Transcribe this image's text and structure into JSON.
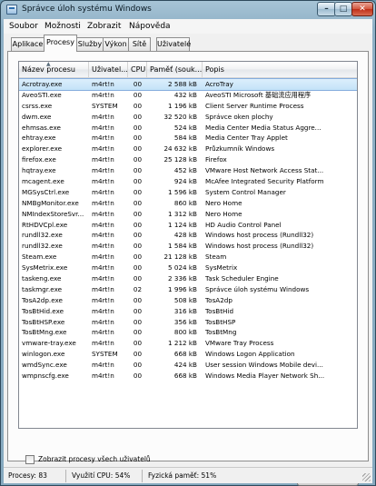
{
  "window": {
    "title": "Správce úloh systému Windows"
  },
  "menu": [
    "Soubor",
    "Možnosti",
    "Zobrazit",
    "Nápověda"
  ],
  "tabs": [
    "Aplikace",
    "Procesy",
    "Služby",
    "Výkon",
    "Sítě",
    "Uživatelé"
  ],
  "active_tab": "Procesy",
  "columns": [
    "Název procesu",
    "Uživatel...",
    "CPU",
    "Paměť (souk...",
    "Popis"
  ],
  "sort_column": "Název procesu",
  "processes": [
    {
      "name": "Acrotray.exe",
      "user": "m4rt!n",
      "cpu": "00",
      "mem": "2 588 kB",
      "desc": "AcroTray"
    },
    {
      "name": "AveoSTI.exe",
      "user": "m4rt!n",
      "cpu": "00",
      "mem": "432 kB",
      "desc": "AveoSTI Microsoft 基础流应用程序"
    },
    {
      "name": "csrss.exe",
      "user": "SYSTEM",
      "cpu": "00",
      "mem": "1 196 kB",
      "desc": "Client Server Runtime Process"
    },
    {
      "name": "dwm.exe",
      "user": "m4rt!n",
      "cpu": "00",
      "mem": "32 520 kB",
      "desc": "Správce oken plochy"
    },
    {
      "name": "ehmsas.exe",
      "user": "m4rt!n",
      "cpu": "00",
      "mem": "524 kB",
      "desc": "Media Center Media Status Aggre..."
    },
    {
      "name": "ehtray.exe",
      "user": "m4rt!n",
      "cpu": "00",
      "mem": "584 kB",
      "desc": "Media Center Tray Applet"
    },
    {
      "name": "explorer.exe",
      "user": "m4rt!n",
      "cpu": "00",
      "mem": "24 632 kB",
      "desc": "Průzkumník Windows"
    },
    {
      "name": "firefox.exe",
      "user": "m4rt!n",
      "cpu": "00",
      "mem": "25 128 kB",
      "desc": "Firefox"
    },
    {
      "name": "hqtray.exe",
      "user": "m4rt!n",
      "cpu": "00",
      "mem": "452 kB",
      "desc": "VMware Host Network Access Stat..."
    },
    {
      "name": "mcagent.exe",
      "user": "m4rt!n",
      "cpu": "00",
      "mem": "924 kB",
      "desc": "McAfee Integrated Security Platform"
    },
    {
      "name": "MGSysCtrl.exe",
      "user": "m4rt!n",
      "cpu": "00",
      "mem": "1 596 kB",
      "desc": "System Control Manager"
    },
    {
      "name": "NMBgMonitor.exe",
      "user": "m4rt!n",
      "cpu": "00",
      "mem": "860 kB",
      "desc": "Nero Home"
    },
    {
      "name": "NMIndexStoreSvr...",
      "user": "m4rt!n",
      "cpu": "00",
      "mem": "1 312 kB",
      "desc": "Nero Home"
    },
    {
      "name": "RtHDVCpl.exe",
      "user": "m4rt!n",
      "cpu": "00",
      "mem": "1 124 kB",
      "desc": "HD Audio Control Panel"
    },
    {
      "name": "rundll32.exe",
      "user": "m4rt!n",
      "cpu": "00",
      "mem": "428 kB",
      "desc": "Windows host process (Rundll32)"
    },
    {
      "name": "rundll32.exe",
      "user": "m4rt!n",
      "cpu": "00",
      "mem": "1 584 kB",
      "desc": "Windows host process (Rundll32)"
    },
    {
      "name": "Steam.exe",
      "user": "m4rt!n",
      "cpu": "00",
      "mem": "21 128 kB",
      "desc": "Steam"
    },
    {
      "name": "SysMetrix.exe",
      "user": "m4rt!n",
      "cpu": "00",
      "mem": "5 024 kB",
      "desc": "SysMetrix"
    },
    {
      "name": "taskeng.exe",
      "user": "m4rt!n",
      "cpu": "00",
      "mem": "2 336 kB",
      "desc": "Task Scheduler Engine"
    },
    {
      "name": "taskmgr.exe",
      "user": "m4rt!n",
      "cpu": "02",
      "mem": "1 996 kB",
      "desc": "Správce úloh systému Windows"
    },
    {
      "name": "TosA2dp.exe",
      "user": "m4rt!n",
      "cpu": "00",
      "mem": "508 kB",
      "desc": "TosA2dp"
    },
    {
      "name": "TosBtHid.exe",
      "user": "m4rt!n",
      "cpu": "00",
      "mem": "316 kB",
      "desc": "TosBtHid"
    },
    {
      "name": "TosBtHSP.exe",
      "user": "m4rt!n",
      "cpu": "00",
      "mem": "356 kB",
      "desc": "TosBtHSP"
    },
    {
      "name": "TosBtMng.exe",
      "user": "m4rt!n",
      "cpu": "00",
      "mem": "800 kB",
      "desc": "TosBtMng"
    },
    {
      "name": "vmware-tray.exe",
      "user": "m4rt!n",
      "cpu": "00",
      "mem": "1 212 kB",
      "desc": "VMware Tray Process"
    },
    {
      "name": "winlogon.exe",
      "user": "SYSTEM",
      "cpu": "00",
      "mem": "668 kB",
      "desc": "Windows Logon Application"
    },
    {
      "name": "wmdSync.exe",
      "user": "m4rt!n",
      "cpu": "00",
      "mem": "424 kB",
      "desc": "User session Windows Mobile devi..."
    },
    {
      "name": "wmpnscfg.exe",
      "user": "m4rt!n",
      "cpu": "00",
      "mem": "668 kB",
      "desc": "Windows Media Player Network Sh..."
    }
  ],
  "selected_row": "Acrotray.exe",
  "show_all_label": "Zobrazit procesy všech uživatelů",
  "show_all_checked": false,
  "end_process_label": "Ukončit proces",
  "status": {
    "processes": "Procesy: 83",
    "cpu": "Využití CPU: 54%",
    "memory": "Fyzická paměť: 51%"
  },
  "title_buttons": {
    "minimize": "–",
    "maximize": "□",
    "close": "✕"
  }
}
